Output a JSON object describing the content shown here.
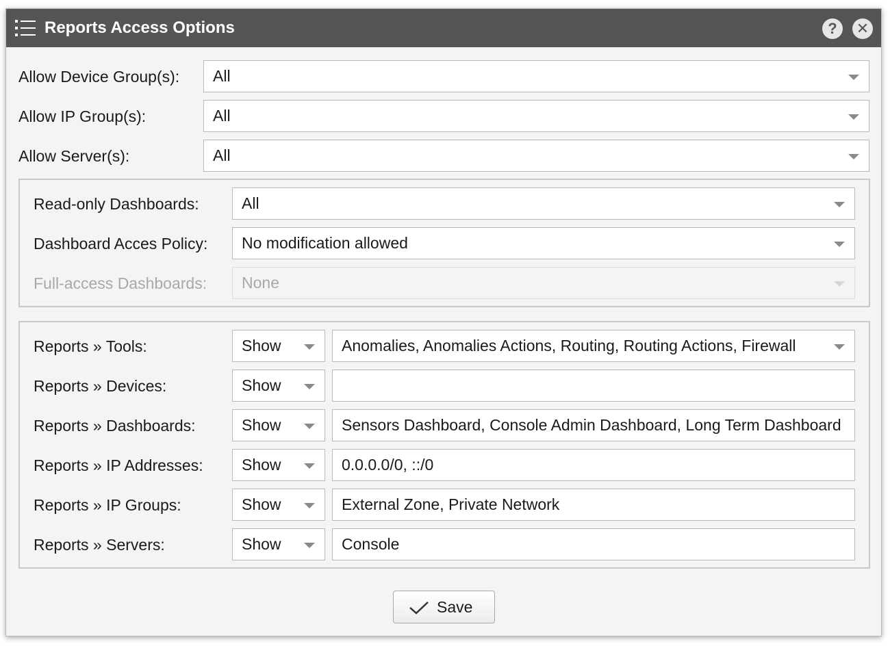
{
  "window": {
    "title": "Reports Access Options"
  },
  "titlebar": {
    "help_glyph": "?",
    "close_glyph": "✕"
  },
  "top_fields": [
    {
      "label": "Allow Device Group(s):",
      "value": "All"
    },
    {
      "label": "Allow IP Group(s):",
      "value": "All"
    },
    {
      "label": "Allow Server(s):",
      "value": "All"
    }
  ],
  "dashboards_panel": {
    "readonly": {
      "label": "Read-only Dashboards:",
      "value": "All"
    },
    "policy": {
      "label": "Dashboard Acces Policy:",
      "value": "No modification allowed"
    },
    "fullaccess": {
      "label": "Full-access Dashboards:",
      "value": "None"
    }
  },
  "reports_panel": {
    "rows": [
      {
        "label": "Reports » Tools:",
        "mode": "Show",
        "value": "Anomalies, Anomalies Actions, Routing, Routing Actions, Firewall"
      },
      {
        "label": "Reports » Devices:",
        "mode": "Show",
        "value": ""
      },
      {
        "label": "Reports » Dashboards:",
        "mode": "Show",
        "value": "Sensors Dashboard, Console Admin Dashboard, Long Term Dashboard"
      },
      {
        "label": "Reports » IP Addresses:",
        "mode": "Show",
        "value": "0.0.0.0/0, ::/0"
      },
      {
        "label": "Reports » IP Groups:",
        "mode": "Show",
        "value": "External Zone, Private Network"
      },
      {
        "label": "Reports » Servers:",
        "mode": "Show",
        "value": "Console"
      }
    ]
  },
  "footer": {
    "save_label": "Save"
  },
  "icons": {
    "title": "list-icon",
    "help": "help-icon",
    "close": "close-icon",
    "dropdown": "caret-down-icon",
    "save": "checkmark-icon"
  },
  "colors": {
    "titlebar": "#555555",
    "body": "#f3f4f6",
    "border": "#b9b9b9",
    "disabled_text": "#a8a8a8"
  }
}
